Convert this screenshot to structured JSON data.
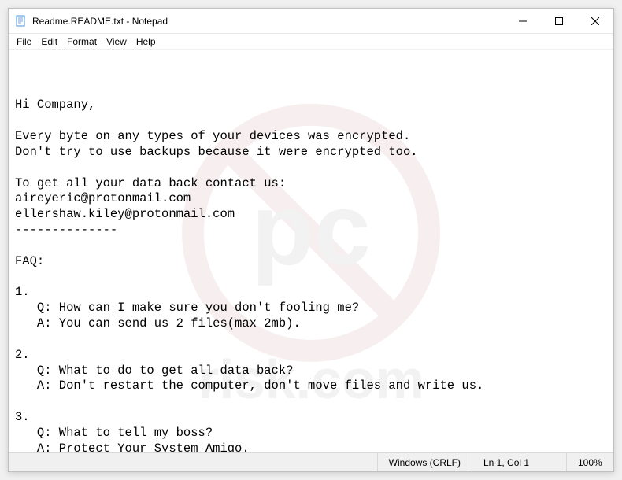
{
  "window": {
    "title": "Readme.README.txt - Notepad"
  },
  "menu": {
    "file": "File",
    "edit": "Edit",
    "format": "Format",
    "view": "View",
    "help": "Help"
  },
  "content": {
    "text": "Hi Company,\n\nEvery byte on any types of your devices was encrypted.\nDon't try to use backups because it were encrypted too.\n\nTo get all your data back contact us:\naireyeric@protonmail.com\nellershaw.kiley@protonmail.com\n--------------\n\nFAQ:\n\n1.\n   Q: How can I make sure you don't fooling me?\n   A: You can send us 2 files(max 2mb).\n\n2.\n   Q: What to do to get all data back?\n   A: Don't restart the computer, don't move files and write us.\n\n3.\n   Q: What to tell my boss?\n   A: Protect Your System Amigo."
  },
  "statusbar": {
    "line_ending": "Windows (CRLF)",
    "position": "Ln 1, Col 1",
    "zoom": "100%"
  },
  "watermark": {
    "text_top": "pc",
    "text_bottom": "risk.com"
  }
}
